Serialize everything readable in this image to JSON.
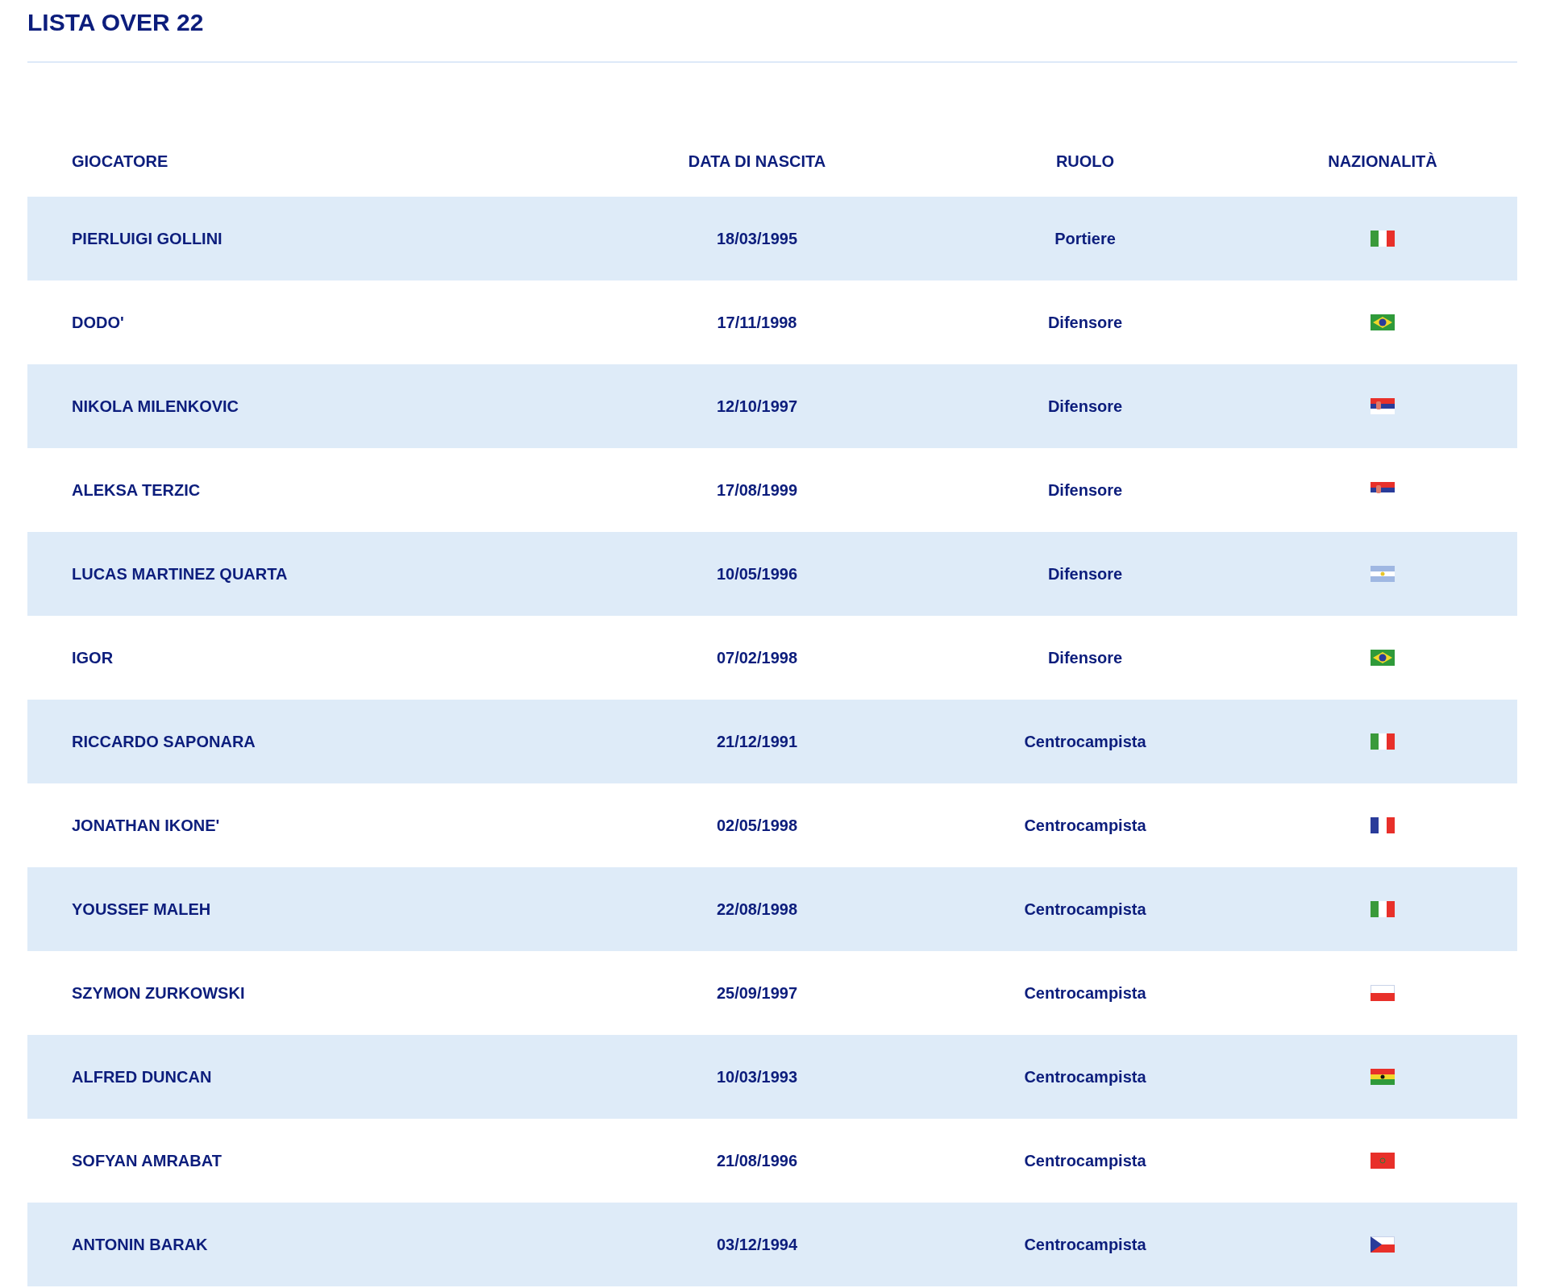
{
  "title": "LISTA OVER 22",
  "table": {
    "columns": [
      "GIOCATORE",
      "DATA DI NASCITA",
      "RUOLO",
      "NAZIONALITÀ"
    ],
    "rows": [
      {
        "player": "PIERLUIGI GOLLINI",
        "birth_date": "18/03/1995",
        "role": "Portiere",
        "kind": "it"
      },
      {
        "player": "DODO'",
        "birth_date": "17/11/1998",
        "role": "Difensore",
        "kind": "br"
      },
      {
        "player": "NIKOLA MILENKOVIC",
        "birth_date": "12/10/1997",
        "role": "Difensore",
        "kind": "rs"
      },
      {
        "player": "ALEKSA TERZIC",
        "birth_date": "17/08/1999",
        "role": "Difensore",
        "kind": "rs"
      },
      {
        "player": "LUCAS MARTINEZ QUARTA",
        "birth_date": "10/05/1996",
        "role": "Difensore",
        "kind": "ar"
      },
      {
        "player": "IGOR",
        "birth_date": "07/02/1998",
        "role": "Difensore",
        "kind": "br"
      },
      {
        "player": "RICCARDO SAPONARA",
        "birth_date": "21/12/1991",
        "role": "Centrocampista",
        "kind": "it"
      },
      {
        "player": "JONATHAN IKONE'",
        "birth_date": "02/05/1998",
        "role": "Centrocampista",
        "kind": "fr"
      },
      {
        "player": "YOUSSEF MALEH",
        "birth_date": "22/08/1998",
        "role": "Centrocampista",
        "kind": "it"
      },
      {
        "player": "SZYMON ZURKOWSKI",
        "birth_date": "25/09/1997",
        "role": "Centrocampista",
        "kind": "pl"
      },
      {
        "player": "ALFRED DUNCAN",
        "birth_date": "10/03/1993",
        "role": "Centrocampista",
        "kind": "gh"
      },
      {
        "player": "SOFYAN AMRABAT",
        "birth_date": "21/08/1996",
        "role": "Centrocampista",
        "kind": "ma"
      },
      {
        "player": "ANTONIN BARAK",
        "birth_date": "03/12/1994",
        "role": "Centrocampista",
        "kind": "cz"
      }
    ]
  }
}
